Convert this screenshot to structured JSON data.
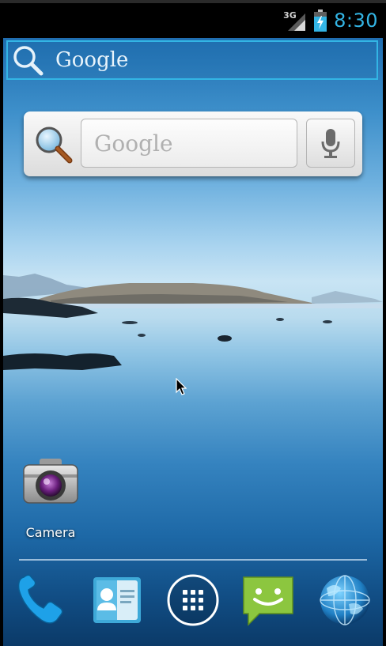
{
  "status_bar": {
    "network_label": "3G",
    "network_icon": "signal-icon",
    "battery_icon": "battery-charging-icon",
    "clock": "8:30",
    "clock_color": "#33b5e5"
  },
  "top_search": {
    "label": "Google",
    "icon": "search-icon",
    "accent": "#33b5e5"
  },
  "search_widget": {
    "field_label": "Google",
    "search_icon": "search-icon",
    "mic_icon": "microphone-icon"
  },
  "shortcuts": [
    {
      "label": "Camera",
      "icon": "camera-icon"
    }
  ],
  "dock": [
    {
      "name": "phone",
      "icon": "phone-icon"
    },
    {
      "name": "contacts",
      "icon": "contacts-icon"
    },
    {
      "name": "all-apps",
      "icon": "apps-grid-icon"
    },
    {
      "name": "messaging",
      "icon": "messaging-icon"
    },
    {
      "name": "browser",
      "icon": "globe-icon"
    }
  ]
}
